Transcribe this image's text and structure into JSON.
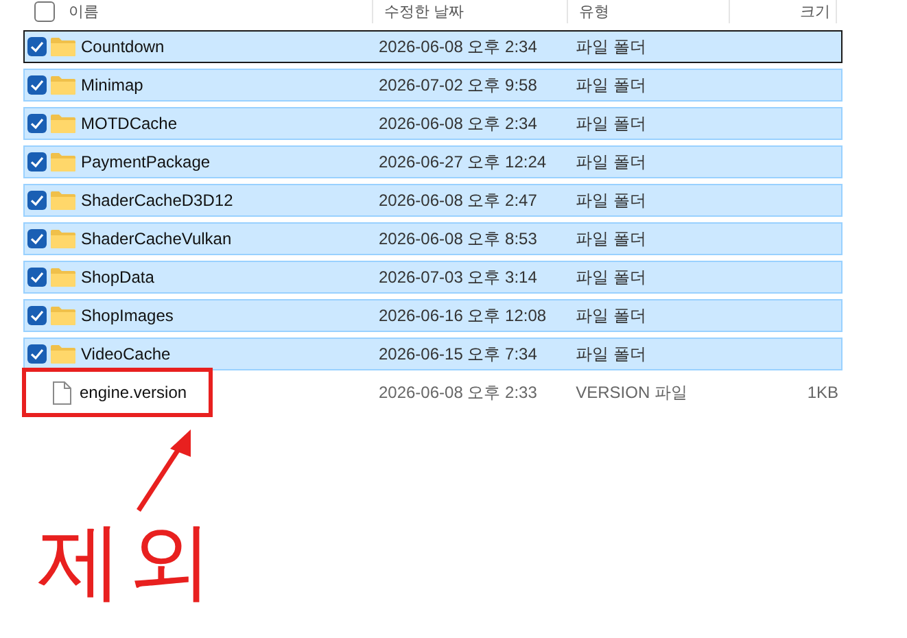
{
  "columns": [
    "이름",
    "수정한 날짜",
    "유형",
    "크기"
  ],
  "header_checkbox": {
    "checked": false
  },
  "rows": [
    {
      "kind": "folder",
      "name": "Countdown",
      "date": "2026-06-08 오후 2:34",
      "type": "파일 폴더",
      "selected": true,
      "checked": true,
      "focused": true
    },
    {
      "kind": "folder",
      "name": "Minimap",
      "date": "2026-07-02 오후 9:58",
      "type": "파일 폴더",
      "selected": true,
      "checked": true,
      "focused": false
    },
    {
      "kind": "folder",
      "name": "MOTDCache",
      "date": "2026-06-08 오후 2:34",
      "type": "파일 폴더",
      "selected": true,
      "checked": true,
      "focused": false
    },
    {
      "kind": "folder",
      "name": "PaymentPackage",
      "date": "2026-06-27 오후 12:24",
      "type": "파일 폴더",
      "selected": true,
      "checked": true,
      "focused": false
    },
    {
      "kind": "folder",
      "name": "ShaderCacheD3D12",
      "date": "2026-06-08 오후 2:47",
      "type": "파일 폴더",
      "selected": true,
      "checked": true,
      "focused": false
    },
    {
      "kind": "folder",
      "name": "ShaderCacheVulkan",
      "date": "2026-06-08 오후 8:53",
      "type": "파일 폴더",
      "selected": true,
      "checked": true,
      "focused": false
    },
    {
      "kind": "folder",
      "name": "ShopData",
      "date": "2026-07-03 오후 3:14",
      "type": "파일 폴더",
      "selected": true,
      "checked": true,
      "focused": false
    },
    {
      "kind": "folder",
      "name": "ShopImages",
      "date": "2026-06-16 오후 12:08",
      "type": "파일 폴더",
      "selected": true,
      "checked": true,
      "focused": false
    },
    {
      "kind": "folder",
      "name": "VideoCache",
      "date": "2026-06-15 오후 7:34",
      "type": "파일 폴더",
      "selected": true,
      "checked": true,
      "focused": false
    },
    {
      "kind": "file",
      "name": "engine.version",
      "date": "2026-06-08 오후 2:33",
      "type": "VERSION 파일",
      "size": "1KB",
      "selected": false,
      "checked": false,
      "focused": false,
      "highlighted": true
    }
  ],
  "annotation": {
    "note": "제외"
  }
}
